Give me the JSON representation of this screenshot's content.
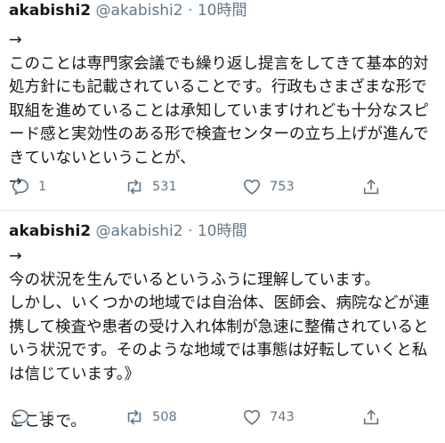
{
  "tweets": [
    {
      "name": "akabishi2",
      "handle": "@akabishi2",
      "separator": "·",
      "time": "10時間",
      "text": "→\nこのことは専門家会議でも繰り返し提言をしてきて基本的対処方針にも記載されていることです。行政もさまざまな形で取組を進めていることは承知していますけれども十分なスピード感と実効性のある形で検査センターの立ち上げが進んできていないということが、\n→",
      "replies": "1",
      "retweets": "531",
      "likes": "753"
    },
    {
      "name": "akabishi2",
      "handle": "@akabishi2",
      "separator": "·",
      "time": "10時間",
      "text": "→\n今の状況を生んでいるというふうに理解しています。\nしかし、いくつかの地域では自治体、医師会、病院などが連携して検査や患者の受け入れ体制が急速に整備されているという状況です。そのような地域では事態は好転していくと私は信じています。》\n\nここまで。",
      "replies": "15",
      "retweets": "508",
      "likes": "743"
    }
  ],
  "icons": {
    "reply": "reply-bubble-icon",
    "retweet": "retweet-arrows-icon",
    "like": "heart-icon",
    "share": "share-upload-icon"
  },
  "colors": {
    "text": "#14171a",
    "secondary": "#657786",
    "divider": "#e1e8ed"
  }
}
